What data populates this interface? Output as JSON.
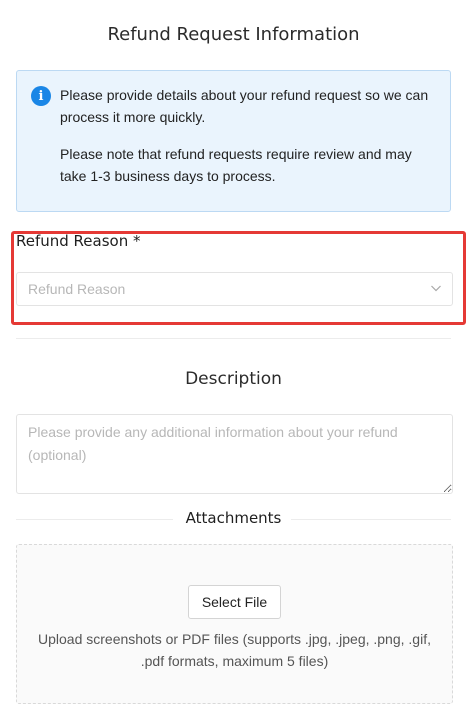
{
  "page": {
    "title": "Refund Request Information"
  },
  "notice": {
    "icon": "info-icon",
    "icon_color": "#1a86e6",
    "paragraph1": "Please provide details about your refund request so we can process it more quickly.",
    "paragraph2": "Please note that refund requests require review and may take 1-3 business days to process."
  },
  "refund_reason": {
    "label": "Refund Reason *",
    "placeholder": "Refund Reason",
    "highlight_color": "#e53935"
  },
  "description": {
    "title": "Description",
    "placeholder": "Please provide any additional information about your refund (optional)"
  },
  "attachments": {
    "title": "Attachments",
    "button_label": "Select File",
    "hint": "Upload screenshots or PDF files (supports .jpg, .jpeg, .png, .gif, .pdf formats, maximum 5 files)"
  }
}
